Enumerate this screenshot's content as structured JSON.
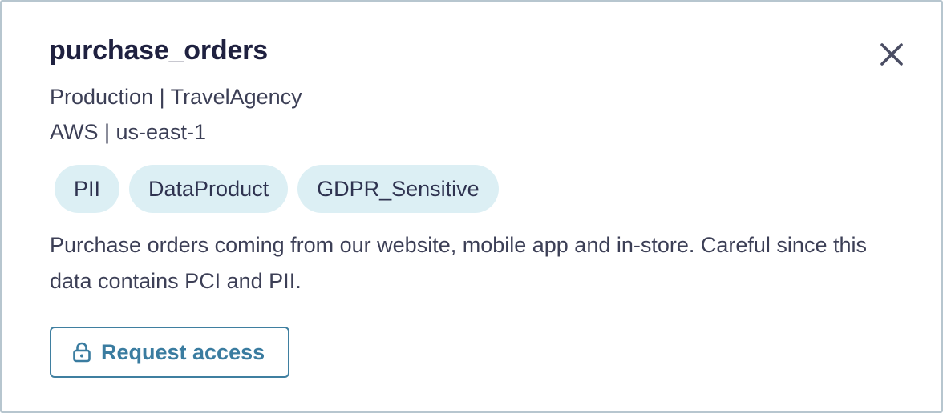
{
  "dataset": {
    "name": "purchase_orders",
    "environment_line": "Production | TravelAgency",
    "location_line": "AWS | us-east-1",
    "tags": [
      "PII",
      "DataProduct",
      "GDPR_Sensitive"
    ],
    "description": "Purchase orders coming from our website, mobile app and in-store. Careful since this data contains PCI and PII."
  },
  "actions": {
    "request_access_label": "Request access",
    "request_access_icon": "lock-icon",
    "close_icon": "close-icon"
  },
  "colors": {
    "accent": "#3a7ca0",
    "tag_background": "#dceff4",
    "title_text": "#1f2140"
  }
}
